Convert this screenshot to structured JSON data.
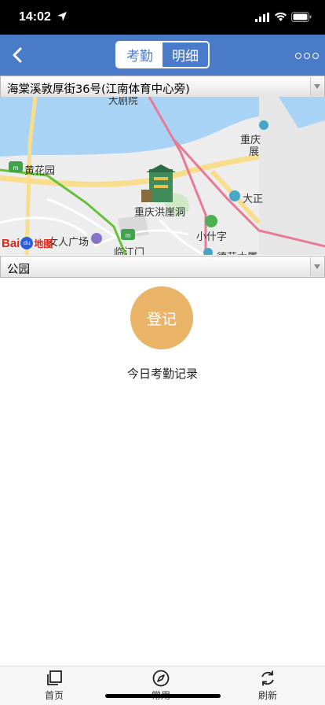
{
  "status_bar": {
    "time": "14:02"
  },
  "header": {
    "tabs": [
      {
        "label": "考勤",
        "active": false
      },
      {
        "label": "明细",
        "active": true
      }
    ]
  },
  "location_select": {
    "value": "海棠溪敦厚街36号(江南体育中心旁)"
  },
  "map": {
    "labels": {
      "huanghuayuan": "黄花园",
      "chongqing_exhibition_1": "重庆",
      "chongqing_exhibition_2": "展",
      "dazheng": "大正",
      "hongyadong": "重庆洪崖洞",
      "xiaoshizi": "小什字",
      "nvren_guangchang": "女人广场",
      "linjiangmen": "临江门",
      "dejiu": "德艺大厦",
      "dajuyuan": "大剧院"
    },
    "logo": {
      "bai": "Bai",
      "paw": "du",
      "ditu": "地图"
    },
    "colors": {
      "water": "#a9d3f5",
      "land": "#ededed",
      "road_yellow": "#f7dd8c",
      "metro_green": "#67c23a",
      "metro_pink": "#e97a95"
    }
  },
  "type_select": {
    "value": "公园"
  },
  "register": {
    "label": "登记",
    "color": "#e9b467"
  },
  "records": {
    "title": "今日考勤记录"
  },
  "tabbar": {
    "items": [
      {
        "label": "首页",
        "icon": "pages-icon"
      },
      {
        "label": "常用",
        "icon": "compass-icon"
      },
      {
        "label": "刷新",
        "icon": "refresh-icon"
      }
    ]
  },
  "colors": {
    "primary": "#4a7bc8",
    "status_bar": "#000000"
  }
}
